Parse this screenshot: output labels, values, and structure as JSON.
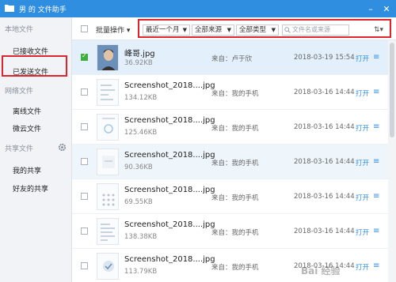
{
  "window": {
    "title": "男 的 文件助手"
  },
  "sidebar": {
    "sections": [
      {
        "label": "本地文件",
        "items": [
          "已接收文件",
          "已发送文件"
        ]
      },
      {
        "label": "网络文件",
        "items": [
          "离线文件",
          "微云文件"
        ]
      },
      {
        "label": "共享文件",
        "items": [
          "我的共享",
          "好友的共享"
        ]
      }
    ],
    "active_item": "已接收文件"
  },
  "toolbar": {
    "batch_label": "批量操作",
    "filters": {
      "time": "最近一个月",
      "source": "全部来源",
      "type": "全部类型"
    },
    "search_placeholder": "文件名或来源",
    "sort_icon": "sort-icon"
  },
  "files": [
    {
      "name": "峰哥.jpg",
      "size": "36.92KB",
      "from": "来自：卢于欣",
      "date": "2018-03-19 15:54",
      "action": "打开",
      "checked": true
    },
    {
      "name": "Screenshot_2018....jpg",
      "size": "134.12KB",
      "from": "来自：我的手机",
      "date": "2018-03-16 14:44",
      "action": "打开",
      "checked": false
    },
    {
      "name": "Screenshot_2018....jpg",
      "size": "125.46KB",
      "from": "来自：我的手机",
      "date": "2018-03-16 14:44",
      "action": "打开",
      "checked": false
    },
    {
      "name": "Screenshot_2018....jpg",
      "size": "90.36KB",
      "from": "来自：我的手机",
      "date": "2018-03-16 14:44",
      "action": "打开",
      "checked": false
    },
    {
      "name": "Screenshot_2018....jpg",
      "size": "69.55KB",
      "from": "来自：我的手机",
      "date": "2018-03-16 14:44",
      "action": "打开",
      "checked": false
    },
    {
      "name": "Screenshot_2018....jpg",
      "size": "138.38KB",
      "from": "来自：我的手机",
      "date": "2018-03-16 14:44",
      "action": "打开",
      "checked": false
    },
    {
      "name": "Screenshot_2018....jpg",
      "size": "113.79KB",
      "from": "来自：我的手机",
      "date": "2018-03-16 14:44",
      "action": "打开",
      "checked": false
    }
  ],
  "colors": {
    "accent": "#2f8ee0",
    "highlight_box": "#e0242c",
    "checked": "#3fae3f"
  },
  "watermark": "Bai 经验"
}
